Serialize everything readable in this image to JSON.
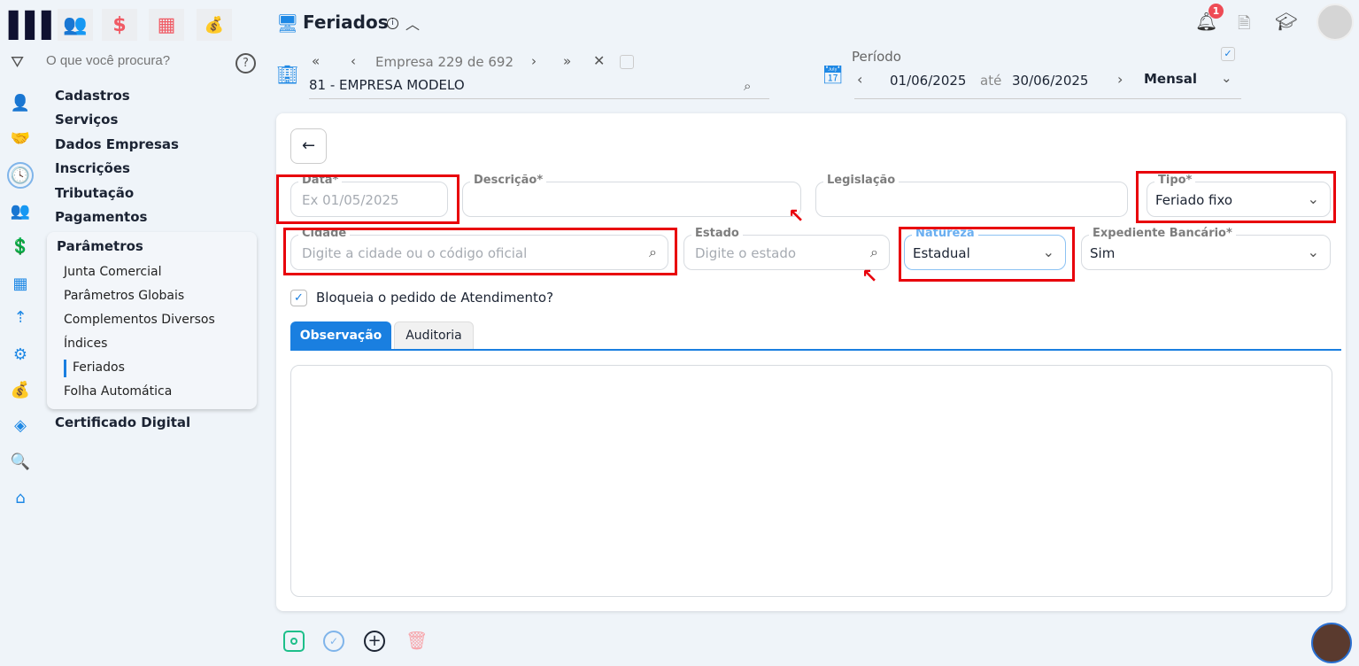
{
  "app": {
    "logo": "M"
  },
  "top_icons": [
    "people-icon",
    "dollar-icon",
    "calculator-icon",
    "money-bag-icon"
  ],
  "search": {
    "placeholder": "O que você procura?"
  },
  "menu": [
    "Cadastros",
    "Serviços",
    "Dados Empresas",
    "Inscrições",
    "Tributação",
    "Pagamentos"
  ],
  "submenu": {
    "title": "Parâmetros",
    "items": [
      "Junta Comercial",
      "Parâmetros Globais",
      "Complementos Diversos",
      "Índices",
      "Feriados",
      "Folha Automática"
    ],
    "active": "Feriados"
  },
  "menu_after": "Certificado Digital",
  "header": {
    "title": "Feriados",
    "notifications": "1"
  },
  "company": {
    "nav_label": "Empresa 229 de 692",
    "value": "81 - EMPRESA MODELO"
  },
  "period": {
    "label": "Período",
    "start": "01/06/2025",
    "sep": "até",
    "end": "30/06/2025",
    "mode": "Mensal"
  },
  "form": {
    "data": {
      "label": "Data*",
      "placeholder": "Ex 01/05/2025"
    },
    "descricao": {
      "label": "Descrição*"
    },
    "legislacao": {
      "label": "Legislação"
    },
    "tipo": {
      "label": "Tipo*",
      "value": "Feriado fixo"
    },
    "cidade": {
      "label": "Cidade",
      "placeholder": "Digite a cidade ou o código oficial"
    },
    "estado": {
      "label": "Estado",
      "placeholder": "Digite o estado"
    },
    "natureza": {
      "label": "Natureza",
      "value": "Estadual"
    },
    "expediente": {
      "label": "Expediente Bancário*",
      "value": "Sim"
    },
    "bloqueia": {
      "label": "Bloqueia o pedido de Atendimento?",
      "checked": true
    }
  },
  "tabs": [
    "Observação",
    "Auditoria"
  ],
  "colors": {
    "accent": "#1a7fe0",
    "highlight": "#e8000b",
    "save": "#1dbf8a"
  }
}
